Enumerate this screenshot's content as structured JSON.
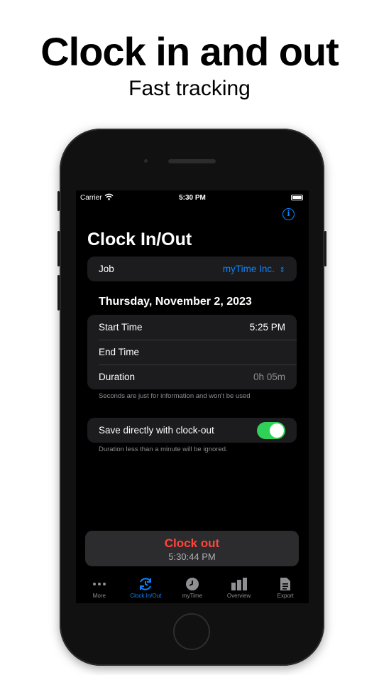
{
  "promo": {
    "headline": "Clock in and out",
    "subhead": "Fast tracking"
  },
  "status_bar": {
    "carrier": "Carrier",
    "time": "5:30 PM"
  },
  "screen": {
    "title": "Clock In/Out",
    "job": {
      "label": "Job",
      "value": "myTime Inc."
    },
    "date": "Thursday, November 2, 2023",
    "times": {
      "start_label": "Start Time",
      "start_value": "5:25 PM",
      "end_label": "End Time",
      "end_value": "",
      "duration_label": "Duration",
      "duration_value": "0h 05m"
    },
    "seconds_note": "Seconds are just for information and won't be used",
    "save_direct": {
      "label": "Save directly with clock-out",
      "enabled": true
    },
    "duration_note": "Duration less than a minute will be ignored.",
    "clock_button": {
      "label": "Clock out",
      "elapsed": "5:30:44 PM"
    }
  },
  "tabbar": {
    "tabs": [
      {
        "label": "More",
        "icon": "more-dots-icon",
        "active": false
      },
      {
        "label": "Clock In/Out",
        "icon": "clock-arrows-icon",
        "active": true
      },
      {
        "label": "myTime",
        "icon": "clock-icon",
        "active": false
      },
      {
        "label": "Overview",
        "icon": "bar-chart-icon",
        "active": false
      },
      {
        "label": "Export",
        "icon": "document-icon",
        "active": false
      }
    ]
  },
  "colors": {
    "accent": "#0a84ff",
    "danger": "#ff453a",
    "toggle_on": "#30d158"
  }
}
